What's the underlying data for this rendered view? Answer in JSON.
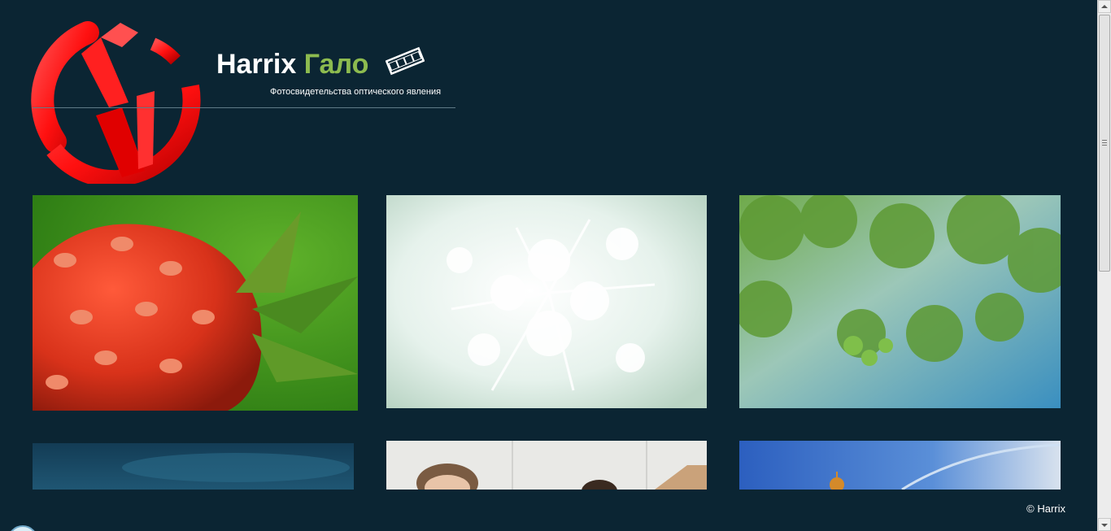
{
  "header": {
    "title_main": "Harrix",
    "title_accent": "Гало",
    "tagline": "Фотосвидетельства оптического явления",
    "logo_icon": "harrix-logo",
    "media_icon": "film-strip-icon"
  },
  "gallery": {
    "photos": [
      {
        "name": "strawberry-photo"
      },
      {
        "name": "white-flower-photo"
      },
      {
        "name": "green-leaves-photo"
      },
      {
        "name": "sky-photo"
      },
      {
        "name": "people-photo"
      },
      {
        "name": "church-photo"
      }
    ]
  },
  "footer": {
    "copyright": "© Harrix"
  },
  "colors": {
    "background": "#0b2533",
    "accent": "#8dbb4f",
    "logo_red": "#ff1a1a"
  }
}
